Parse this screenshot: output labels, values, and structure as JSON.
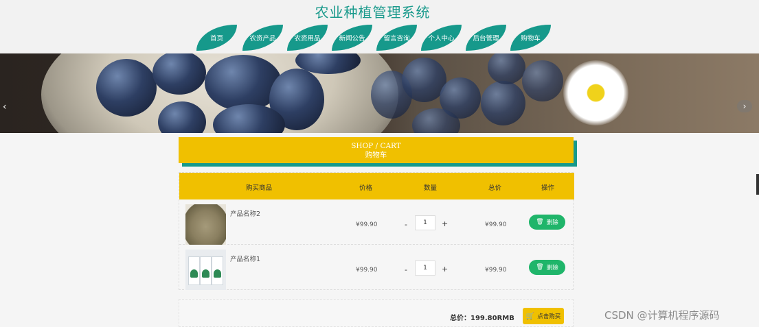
{
  "header": {
    "title": "农业种植管理系统",
    "nav": [
      "首页",
      "农资产品",
      "农资用品",
      "新闻公告",
      "留言咨询",
      "个人中心",
      "后台管理",
      "购物车"
    ]
  },
  "banner": {
    "prev_icon": "chevron-left-icon",
    "next_icon": "chevron-right-icon"
  },
  "section": {
    "title_en": "SHOP / CART",
    "title_cn": "购物车"
  },
  "cart": {
    "columns": [
      "购买商品",
      "价格",
      "数量",
      "总价",
      "操作"
    ],
    "items": [
      {
        "name": "产品名称2",
        "price": "¥99.90",
        "qty": "1",
        "total": "¥99.90",
        "delete": "删除",
        "minus": "-",
        "plus": "+"
      },
      {
        "name": "产品名称1",
        "price": "¥99.90",
        "qty": "1",
        "total": "¥99.90",
        "delete": "删除",
        "minus": "-",
        "plus": "+"
      }
    ]
  },
  "summary": {
    "total_label": "总价：199.80RMB",
    "buy_label": "点击购买"
  },
  "watermark": "CSDN @计算机程序源码",
  "colors": {
    "brand": "#16998b",
    "accent": "#f0c000",
    "delete": "#1fb56a"
  }
}
